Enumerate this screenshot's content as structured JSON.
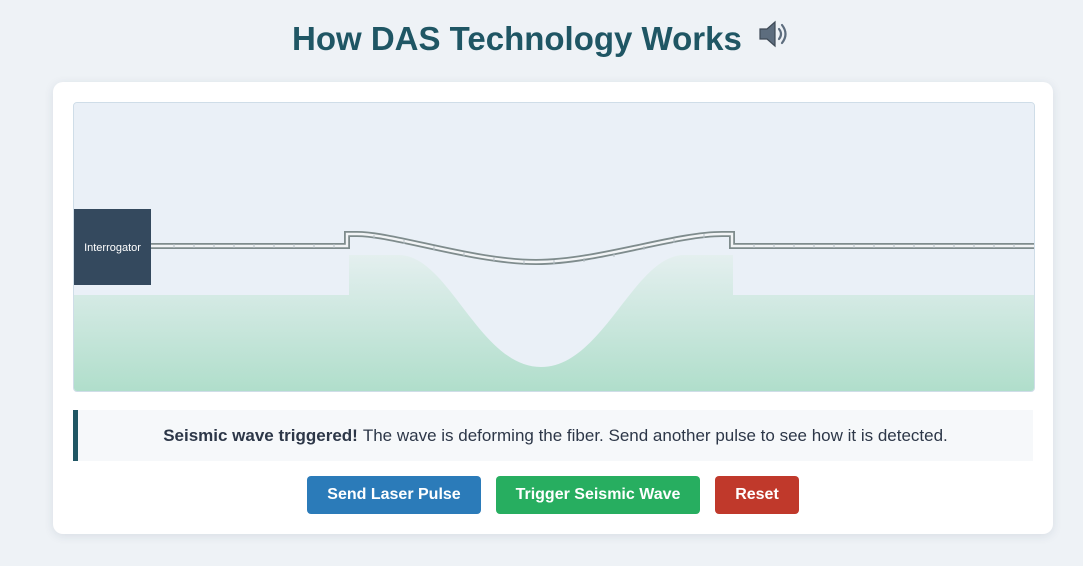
{
  "page": {
    "title": "How DAS Technology Works",
    "title_icon": "speaker-icon"
  },
  "simulation": {
    "interrogator_label": "Interrogator",
    "ground_color": "#b0decb",
    "sky_color": "#eaf0f7",
    "interrogator_color": "#34495e",
    "fiber_color": "#7f8c8d"
  },
  "status": {
    "bold_text": "Seismic wave triggered!",
    "text": "The wave is deforming the fiber. Send another pulse to see how it is detected."
  },
  "controls": {
    "send_pulse_label": "Send Laser Pulse",
    "seismic_label": "Trigger Seismic Wave",
    "reset_label": "Reset",
    "colors": {
      "pulse": "#2b7bb9",
      "seismic": "#27ae60",
      "reset": "#c0392b"
    }
  }
}
